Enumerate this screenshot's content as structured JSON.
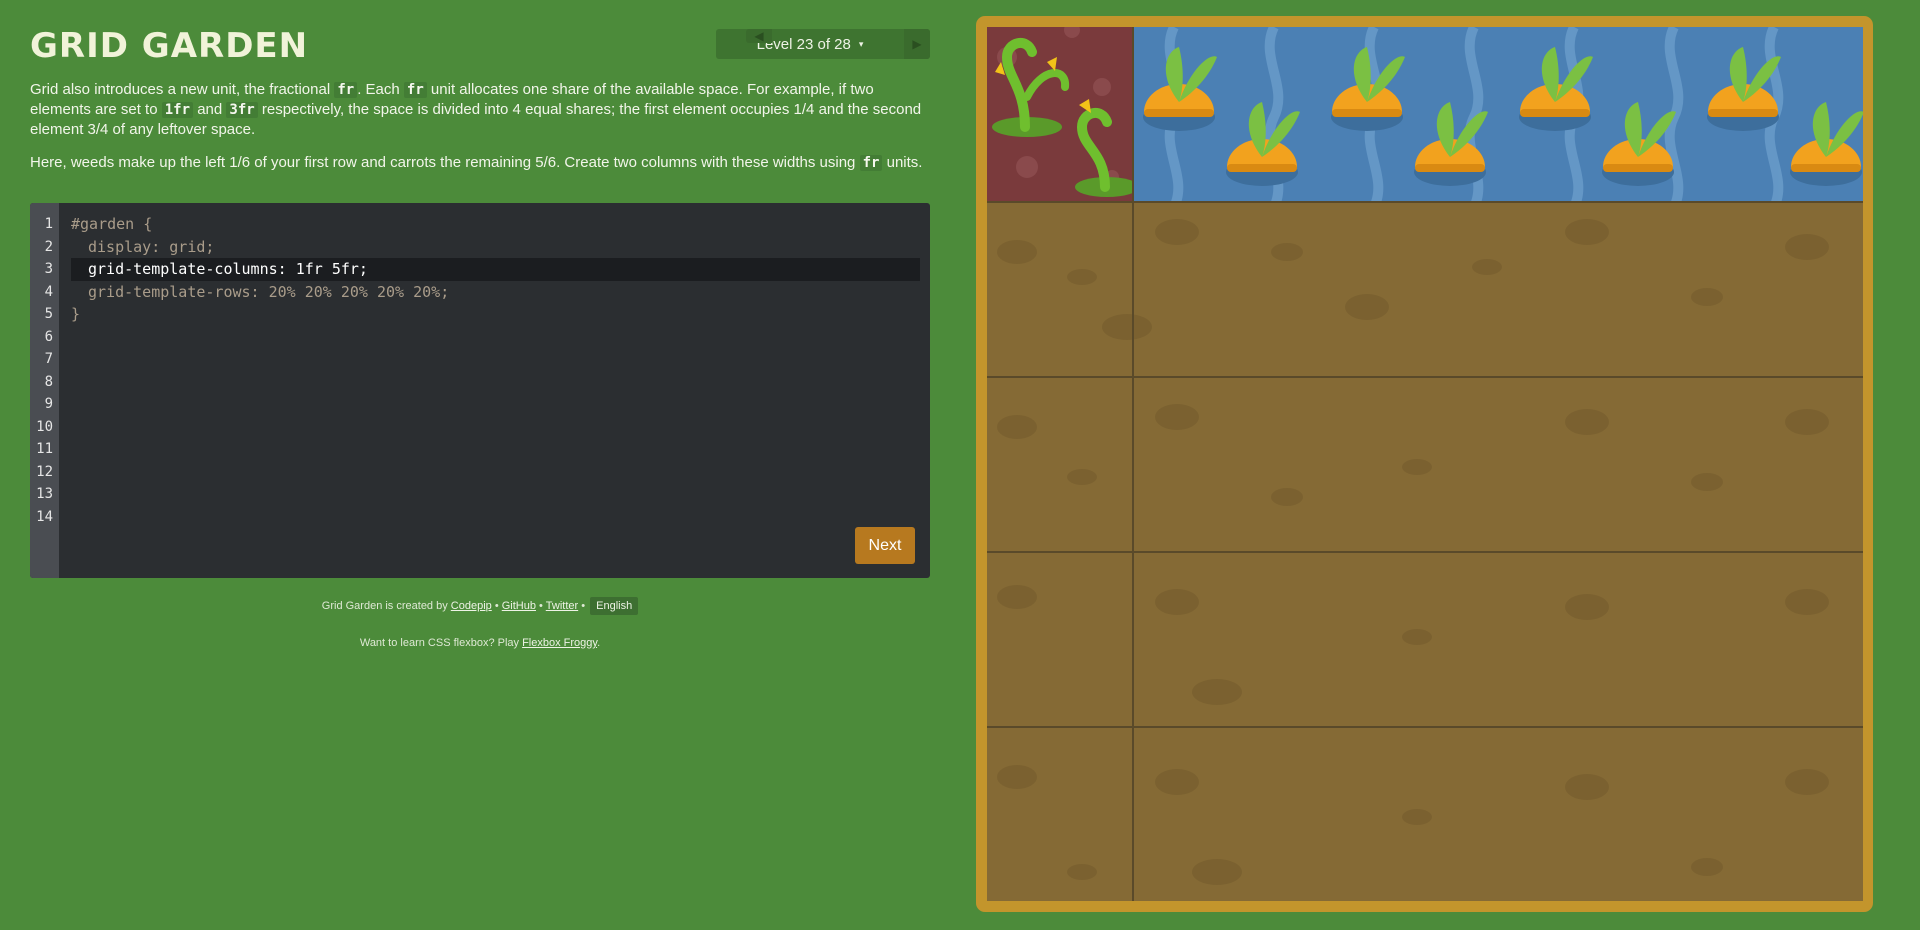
{
  "header": {
    "title": "GRID GARDEN",
    "level_label": "Level 23 of 28",
    "prev_arrow": "◀",
    "next_arrow": "▶",
    "caret": "▾"
  },
  "instructions": {
    "p1_a": "Grid also introduces a new unit, the fractional ",
    "p1_code1": "fr",
    "p1_b": ". Each ",
    "p1_code2": "fr",
    "p1_c": " unit allocates one share of the available space. For example, if two elements are set to ",
    "p1_code3": "1fr",
    "p1_d": " and ",
    "p1_code4": "3fr",
    "p1_e": " respectively, the space is divided into 4 equal shares; the first element occupies 1/4 and the second element 3/4 of any leftover space.",
    "p2_a": "Here, weeds make up the left 1/6 of your first row and carrots the remaining 5/6. Create two columns with these widths using ",
    "p2_code": "fr",
    "p2_b": " units."
  },
  "editor": {
    "line_numbers": [
      "1",
      "2",
      "3",
      "4",
      "5",
      "6",
      "7",
      "8",
      "9",
      "10",
      "11",
      "12",
      "13",
      "14"
    ],
    "lines": {
      "l1": "#garden {",
      "l2": "display: grid;",
      "l3": "grid-template-columns: 1fr 5fr;",
      "l4": "grid-template-rows: 20% 20% 20% 20% 20%;",
      "l5": "}"
    },
    "next_label": "Next"
  },
  "footer": {
    "credit_prefix": "Grid Garden is created by ",
    "codepip": "Codepip",
    "sep": " • ",
    "github": "GitHub",
    "twitter": "Twitter",
    "language": "English",
    "froggy_prefix": "Want to learn CSS flexbox? Play ",
    "froggy_link": "Flexbox Froggy",
    "froggy_suffix": "."
  },
  "colors": {
    "background": "#4c8b3a",
    "frame": "#c3952c",
    "soil": "#856a35",
    "weeds_bg": "#7a3a3c",
    "water_bg": "#4b80b4",
    "carrot": "#f2a21e",
    "leaf": "#7bc043",
    "next_button": "#b7791f"
  }
}
